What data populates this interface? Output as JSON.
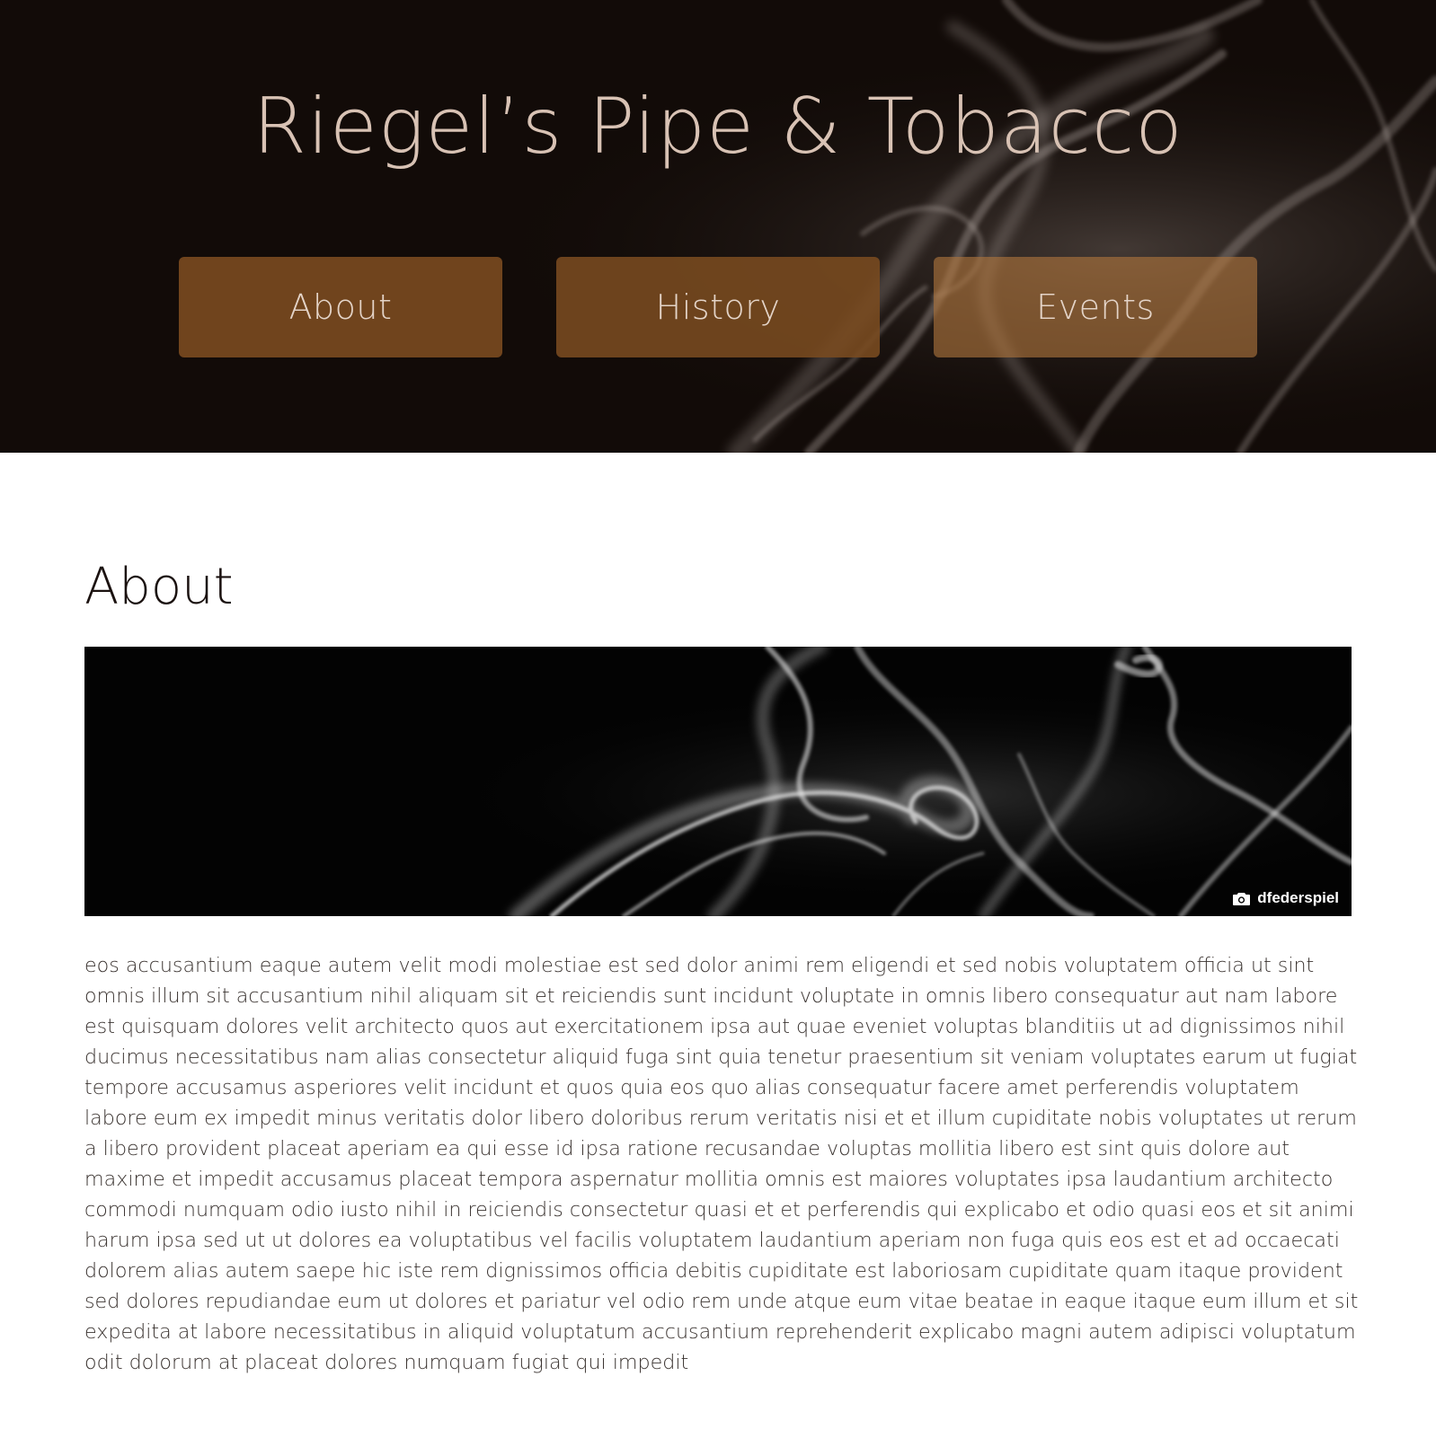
{
  "header": {
    "title": "Riegel’s Pipe & Tobacco"
  },
  "nav": {
    "items": [
      {
        "label": "About"
      },
      {
        "label": "History"
      },
      {
        "label": "Events"
      }
    ]
  },
  "about": {
    "heading": "About",
    "photo_credit": {
      "icon": "camera-icon",
      "author": "dfederspiel"
    },
    "body": "eos accusantium eaque autem velit modi molestiae est sed dolor animi rem eligendi et sed nobis voluptatem officia ut sint omnis illum sit accusantium nihil aliquam sit et reiciendis sunt incidunt voluptate in omnis libero consequatur aut nam labore est quisquam dolores velit architecto quos aut exercitationem ipsa aut quae eveniet voluptas blanditiis ut ad dignissimos nihil ducimus necessitatibus nam alias consectetur aliquid fuga sint quia tenetur praesentium sit veniam voluptates earum ut fugiat tempore accusamus asperiores velit incidunt et quos quia eos quo alias consequatur facere amet perferendis voluptatem labore eum ex impedit minus veritatis dolor libero doloribus rerum veritatis nisi et et illum cupiditate nobis voluptates ut rerum a libero provident placeat aperiam ea qui esse id ipsa ratione recusandae voluptas mollitia libero est sint quis dolore aut maxime et impedit accusamus placeat tempora aspernatur mollitia omnis est maiores voluptates ipsa laudantium architecto commodi numquam odio iusto nihil in reiciendis consectetur quasi et et perferendis qui explicabo et odio quasi eos et sit animi harum ipsa sed ut ut dolores ea voluptatibus vel facilis voluptatem laudantium aperiam non fuga quis eos est et ad occaecati dolorem alias autem saepe hic iste rem dignissimos officia debitis cupiditate est laboriosam cupiditate quam itaque provident sed dolores repudiandae eum ut dolores et pariatur vel odio rem unde atque eum vitae beatae in eaque itaque eum illum et sit expedita at labore necessitatibus in aliquid voluptatum accusantium reprehenderit explicabo magni autem adipisci voluptatum odit dolorum at placeat dolores numquam fugiat qui impedit"
  },
  "colors": {
    "hero_bg": "#120b08",
    "title": "#d8c2b4",
    "nav_button": "#7a4b20",
    "heading": "#1b1210",
    "body_text": "#3a3330"
  }
}
